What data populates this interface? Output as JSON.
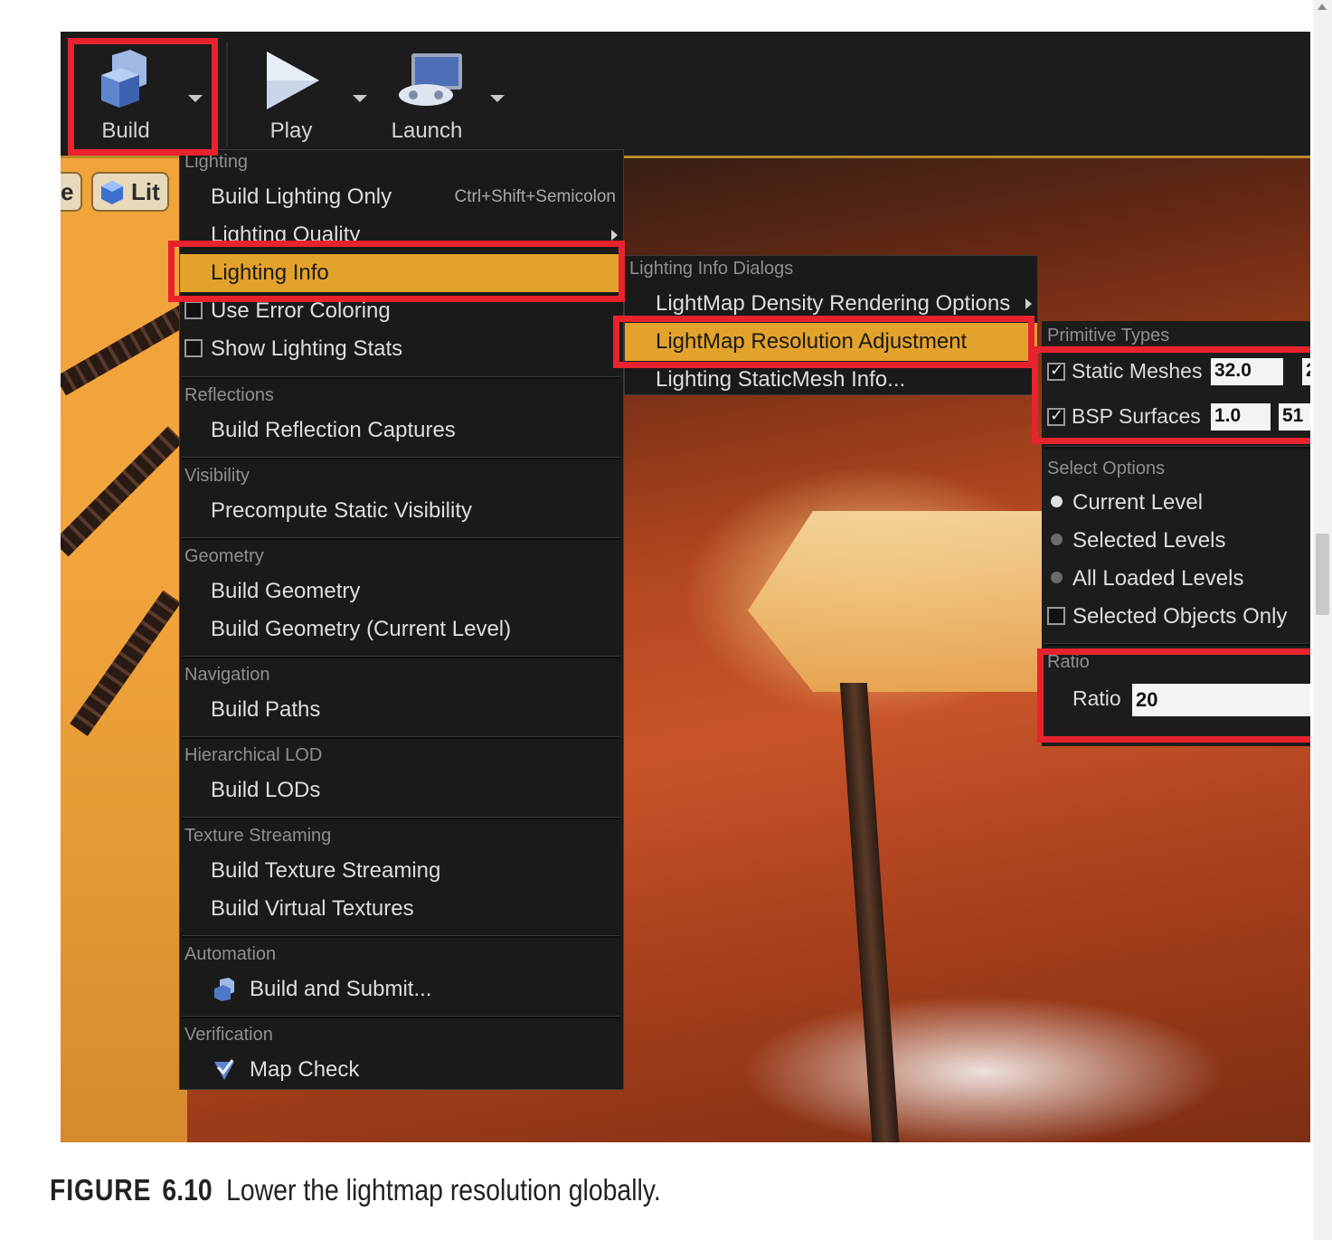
{
  "toolbar": {
    "build_label": "Build",
    "play_label": "Play",
    "launch_label": "Launch"
  },
  "viewport": {
    "mode_partial": "e",
    "lit_label": "Lit"
  },
  "build_menu": {
    "lighting_header": "Lighting",
    "build_lighting_only": "Build Lighting Only",
    "build_lighting_only_shortcut": "Ctrl+Shift+Semicolon",
    "lighting_quality": "Lighting Quality",
    "lighting_info": "Lighting Info",
    "use_error_coloring": "Use Error Coloring",
    "show_lighting_stats": "Show Lighting Stats",
    "reflections_header": "Reflections",
    "build_reflection_captures": "Build Reflection Captures",
    "visibility_header": "Visibility",
    "precompute_static_visibility": "Precompute Static Visibility",
    "geometry_header": "Geometry",
    "build_geometry": "Build Geometry",
    "build_geometry_current": "Build Geometry (Current Level)",
    "navigation_header": "Navigation",
    "build_paths": "Build Paths",
    "hlod_header": "Hierarchical LOD",
    "build_lods": "Build LODs",
    "texture_streaming_header": "Texture Streaming",
    "build_texture_streaming": "Build Texture Streaming",
    "build_virtual_textures": "Build Virtual Textures",
    "automation_header": "Automation",
    "build_and_submit": "Build and Submit...",
    "verification_header": "Verification",
    "map_check": "Map Check"
  },
  "lighting_info_menu": {
    "header": "Lighting Info Dialogs",
    "lightmap_density": "LightMap Density Rendering Options",
    "lightmap_resolution": "LightMap Resolution Adjustment",
    "staticmesh_info": "Lighting StaticMesh Info..."
  },
  "resolution_panel": {
    "primitive_types_header": "Primitive Types",
    "static_meshes_label": "Static Meshes",
    "static_meshes_value": "32.0",
    "static_meshes_next": "2",
    "bsp_surfaces_label": "BSP Surfaces",
    "bsp_surfaces_value": "1.0",
    "bsp_surfaces_next": "51",
    "select_options_header": "Select Options",
    "current_level": "Current Level",
    "selected_levels": "Selected Levels",
    "all_loaded_levels": "All Loaded Levels",
    "selected_objects_only": "Selected Objects Only",
    "ratio_header": "Ratio",
    "ratio_label": "Ratio",
    "ratio_value": "20"
  },
  "caption": {
    "figure_word": "FIGURE",
    "figure_number": "6.10",
    "text": "Lower the lightmap resolution globally."
  },
  "colors": {
    "highlight": "#e8232e",
    "menu_active": "#e3a22b",
    "menu_bg": "#1a1a1a"
  }
}
